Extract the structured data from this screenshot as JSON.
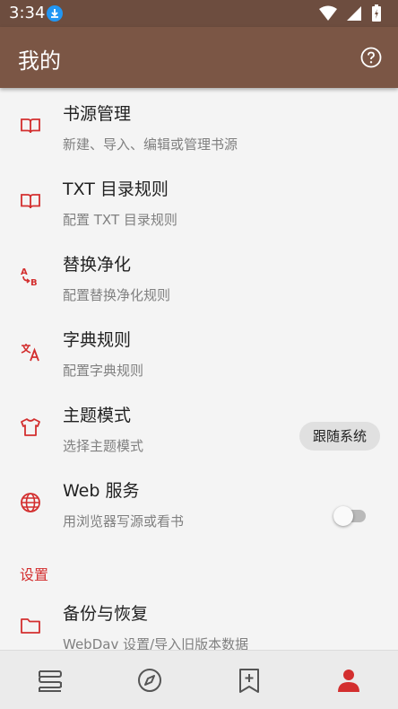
{
  "status": {
    "time": "3:34"
  },
  "appbar": {
    "title": "我的"
  },
  "items": [
    {
      "title": "书源管理",
      "subtitle": "新建、导入、编辑或管理书源",
      "icon": "book-open-icon"
    },
    {
      "title": "TXT 目录规则",
      "subtitle": "配置 TXT 目录规则",
      "icon": "book-open-icon"
    },
    {
      "title": "替换净化",
      "subtitle": "配置替换净化规则",
      "icon": "replace-ab-icon"
    },
    {
      "title": "字典规则",
      "subtitle": "配置字典规则",
      "icon": "translate-icon"
    },
    {
      "title": "主题模式",
      "subtitle": "选择主题模式",
      "icon": "tshirt-icon",
      "value": "跟随系统"
    },
    {
      "title": "Web 服务",
      "subtitle": "用浏览器写源或看书",
      "icon": "globe-icon",
      "switch_on": false
    }
  ],
  "section": {
    "label": "设置"
  },
  "backup": {
    "title": "备份与恢复",
    "subtitle": "WebDav 设置/导入旧版本数据",
    "icon": "folder-icon"
  },
  "bottom_nav": [
    {
      "icon": "bookshelf-icon",
      "active": false
    },
    {
      "icon": "compass-icon",
      "active": false
    },
    {
      "icon": "bookmark-add-icon",
      "active": false
    },
    {
      "icon": "person-icon",
      "active": true
    }
  ],
  "colors": {
    "accent": "#d32f2f",
    "appbar": "#7b5645",
    "statusbar": "#6d4d3f"
  }
}
